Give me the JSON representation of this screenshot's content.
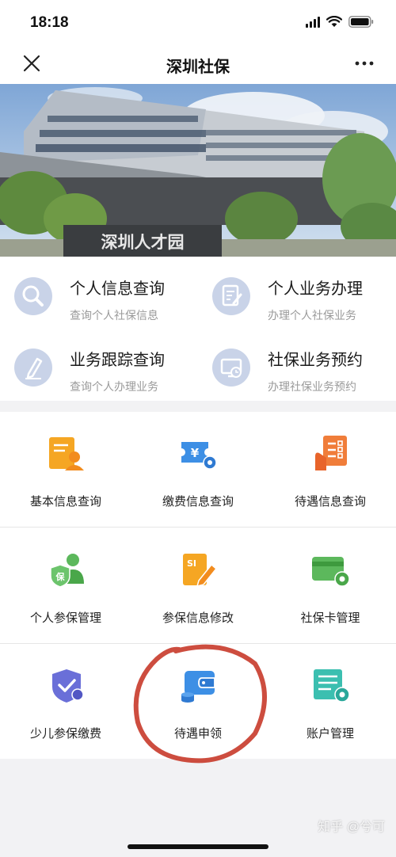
{
  "status_bar": {
    "time": "18:18"
  },
  "nav": {
    "title": "深圳社保"
  },
  "banner": {
    "sign_text": "深圳人才园"
  },
  "quick": [
    {
      "title": "个人信息查询",
      "subtitle": "查询个人社保信息"
    },
    {
      "title": "个人业务办理",
      "subtitle": "办理个人社保业务"
    },
    {
      "title": "业务跟踪查询",
      "subtitle": "查询个人办理业务"
    },
    {
      "title": "社保业务预约",
      "subtitle": "办理社保业务预约"
    }
  ],
  "grid": [
    {
      "label": "基本信息查询",
      "icon": "profile-card-icon"
    },
    {
      "label": "缴费信息查询",
      "icon": "yuan-ticket-icon"
    },
    {
      "label": "待遇信息查询",
      "icon": "checklist-hand-icon"
    },
    {
      "label": "个人参保管理",
      "icon": "insured-person-icon"
    },
    {
      "label": "参保信息修改",
      "icon": "edit-document-icon"
    },
    {
      "label": "社保卡管理",
      "icon": "card-settings-icon"
    },
    {
      "label": "少儿参保缴费",
      "icon": "child-shield-icon"
    },
    {
      "label": "待遇申领",
      "icon": "wallet-icon"
    },
    {
      "label": "账户管理",
      "icon": "list-settings-icon"
    }
  ],
  "annotation": {
    "color": "#c83a2a"
  },
  "watermark": {
    "text": "知乎 @兮可"
  },
  "colors": {
    "orange": "#f5a623",
    "blue": "#3d8fe5",
    "green": "#5cb85c",
    "quick_icon_bg": "#c9d3e8",
    "red_circle": "#c83a2a"
  }
}
